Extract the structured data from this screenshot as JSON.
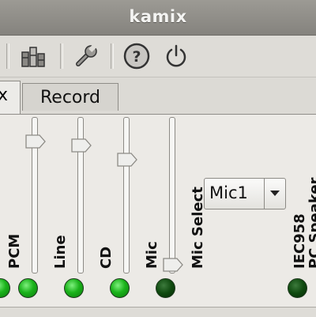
{
  "window": {
    "title": "kamix"
  },
  "toolbar": {
    "icons": [
      "mixer-icon",
      "settings-wrench-icon",
      "help-icon",
      "power-icon"
    ]
  },
  "tabs": [
    {
      "label": "x",
      "active": true
    },
    {
      "label": "Record",
      "active": false
    }
  ],
  "channels": [
    {
      "label": "PCM",
      "level": 0.83,
      "enabled": true
    },
    {
      "label": "Line",
      "level": 0.83,
      "enabled": true
    },
    {
      "label": "CD",
      "level": 0.7,
      "enabled": true
    },
    {
      "label": "Mic",
      "level": 0.0,
      "enabled": false
    },
    {
      "label": "IEC958",
      "enabled": false
    },
    {
      "label": "PC Speaker"
    }
  ],
  "mic_select": {
    "label": "Mic Select",
    "value": "Mic1"
  },
  "colors": {
    "led_on": "#1bb31b",
    "led_off": "#0f4a0f",
    "titlebar": "#8f8d88"
  }
}
